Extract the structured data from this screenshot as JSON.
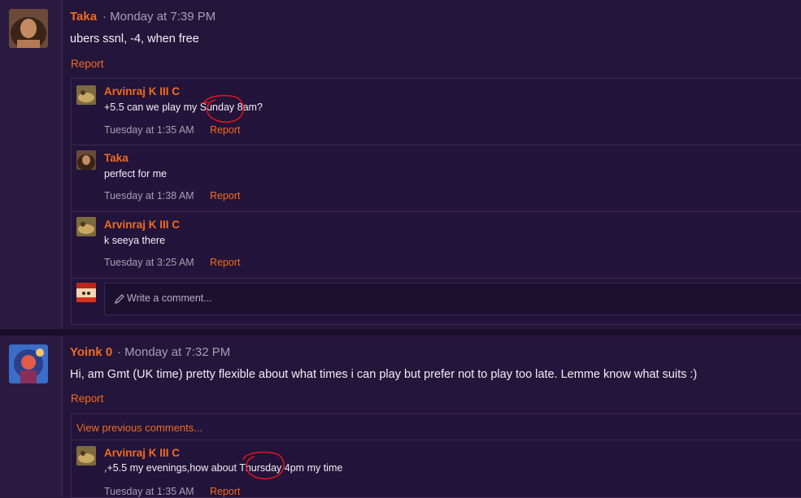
{
  "posts": [
    {
      "author": "Taka",
      "meta": "· Monday at 7:39 PM",
      "text": "ubers ssnl, -4, when free",
      "report": "Report",
      "comments": [
        {
          "author": "Arvinraj K III C",
          "text": "+5.5 can we play my Sunday 8am?",
          "time": "Tuesday at 1:35 AM",
          "report": "Report"
        },
        {
          "author": "Taka",
          "text": "perfect for me",
          "time": "Tuesday at 1:38 AM",
          "report": "Report"
        },
        {
          "author": "Arvinraj K III C",
          "text": "k seeya there",
          "time": "Tuesday at 3:25 AM",
          "report": "Report"
        }
      ],
      "write_placeholder": "Write a comment..."
    },
    {
      "author": "Yoink 0",
      "meta": "· Monday at 7:32 PM",
      "text": "Hi, am Gmt (UK time) pretty flexible about what times i can play but prefer not to play too late. Lemme know what suits :)",
      "report": "Report",
      "view_previous": "View previous comments...",
      "comments": [
        {
          "author": "Arvinraj K III C",
          "text": ",+5.5 my evenings,how about Thursday 4pm my time",
          "time": "Tuesday at 1:35 AM",
          "report": "Report"
        }
      ]
    }
  ],
  "colors": {
    "accent": "#f26b1d",
    "background": "#24153a",
    "annotation": "#e0141e"
  },
  "icons": [
    "pencil-icon"
  ]
}
